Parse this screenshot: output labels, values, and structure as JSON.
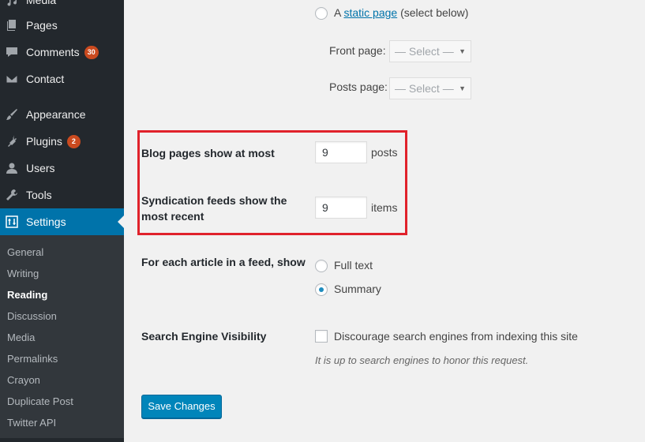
{
  "sidebar": {
    "media_label": "Media",
    "items": [
      {
        "label": "Pages",
        "icon": "pages-icon"
      },
      {
        "label": "Comments",
        "badge": "30",
        "icon": "comments-icon"
      },
      {
        "label": "Contact",
        "icon": "mail-icon"
      },
      {
        "label": "Appearance",
        "icon": "brush-icon"
      },
      {
        "label": "Plugins",
        "badge": "2",
        "icon": "plugin-icon"
      },
      {
        "label": "Users",
        "icon": "users-icon"
      },
      {
        "label": "Tools",
        "icon": "wrench-icon"
      },
      {
        "label": "Settings",
        "icon": "settings-icon"
      }
    ],
    "submenu": [
      "General",
      "Writing",
      "Reading",
      "Discussion",
      "Media",
      "Permalinks",
      "Crayon",
      "Duplicate Post",
      "Twitter API"
    ]
  },
  "homepage": {
    "static_prefix": "A",
    "static_link": "static page",
    "static_suffix": "(select below)",
    "front_label": "Front page:",
    "posts_label": "Posts page:",
    "select_placeholder": "— Select —"
  },
  "blog_pages": {
    "label": "Blog pages show at most",
    "value": "9",
    "unit": "posts"
  },
  "syndication": {
    "label_line1": "Syndication feeds show the",
    "label_line2": "most recent",
    "value": "9",
    "unit": "items"
  },
  "feed_article": {
    "label": "For each article in a feed, show",
    "option_full": "Full text",
    "option_summary": "Summary",
    "selected": "Summary"
  },
  "search_visibility": {
    "label": "Search Engine Visibility",
    "checkbox_label": "Discourage search engines from indexing this site",
    "description": "It is up to search engines to honor this request.",
    "checked": false
  },
  "save_label": "Save Changes",
  "colors": {
    "highlight": "#e0222b",
    "accent": "#0073aa",
    "badge": "#ca4a1f"
  }
}
